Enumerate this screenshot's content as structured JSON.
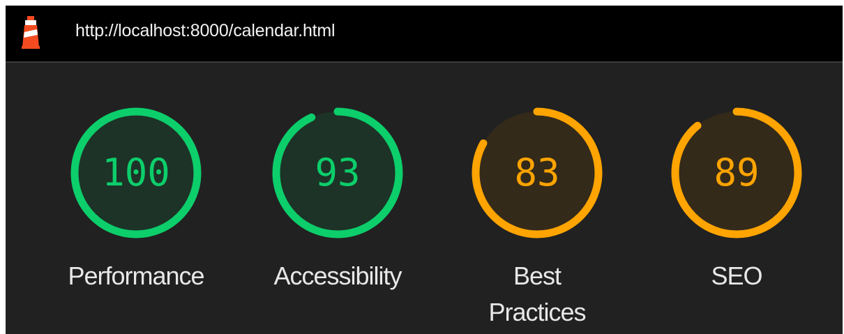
{
  "page": {
    "url": "http://localhost:8000/calendar.html"
  },
  "colors": {
    "pass": "#0cce6b",
    "pass_fill": "#1d3327",
    "average": "#ffa400",
    "average_fill": "#342a1a",
    "background": "#212121",
    "topbar": "#000000"
  },
  "gauges": [
    {
      "label": "Performance",
      "score": "100",
      "value": 100,
      "rating": "pass"
    },
    {
      "label": "Accessibility",
      "score": "93",
      "value": 93,
      "rating": "pass"
    },
    {
      "label": "Best Practices",
      "score": "83",
      "value": 83,
      "rating": "average"
    },
    {
      "label": "SEO",
      "score": "89",
      "value": 89,
      "rating": "average"
    }
  ],
  "icons": {
    "logo": "lighthouse-icon"
  }
}
